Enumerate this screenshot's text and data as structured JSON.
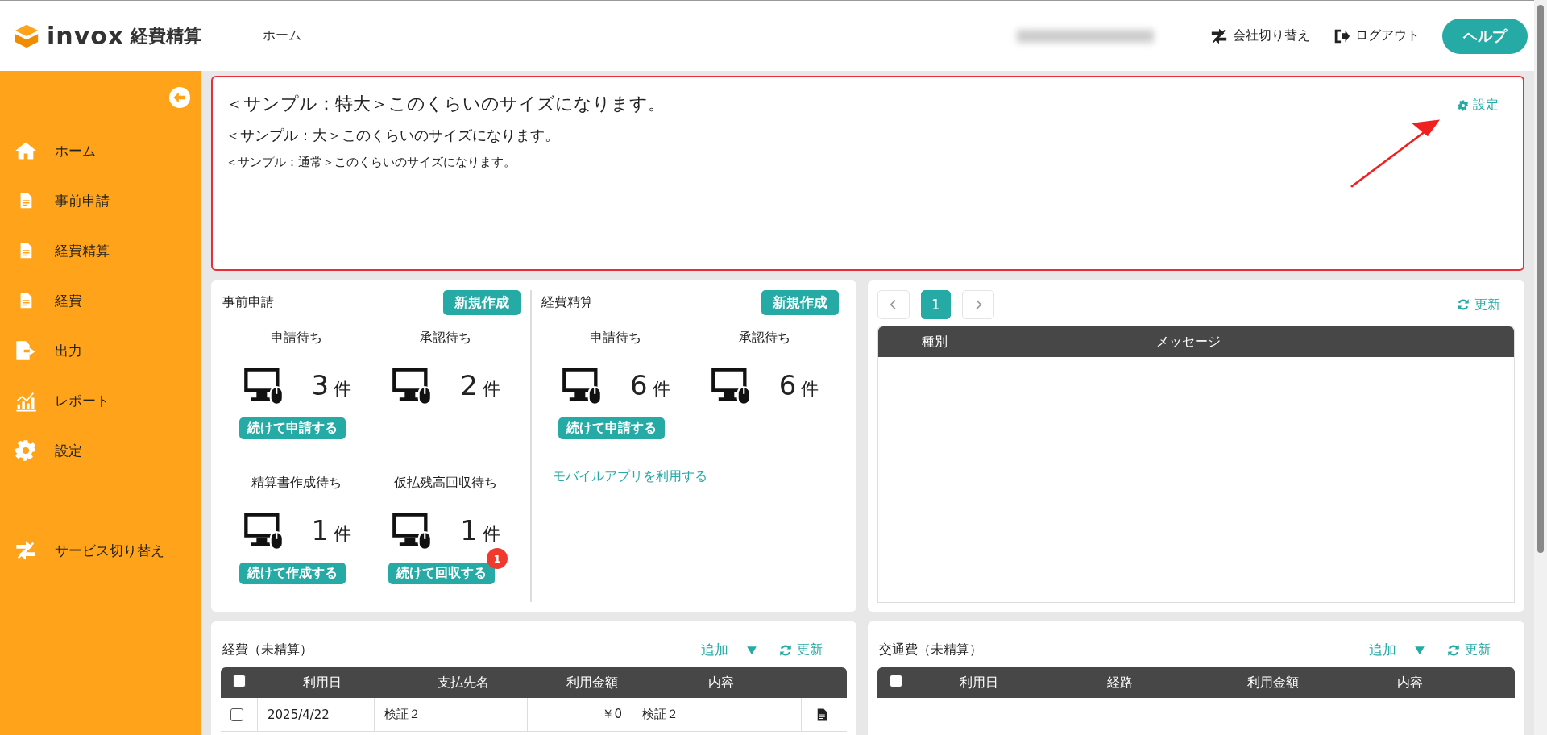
{
  "header": {
    "logo": "invox",
    "product": "経費精算",
    "nav": [
      {
        "label": "ホーム"
      }
    ],
    "actions": [
      {
        "kind": "switch",
        "label": "会社切り替え"
      },
      {
        "kind": "logout",
        "label": "ログアウト"
      }
    ],
    "help": "ヘルプ"
  },
  "sidebar": {
    "items": [
      {
        "kind": "home",
        "label": "ホーム"
      },
      {
        "kind": "doc",
        "label": "事前申請"
      },
      {
        "kind": "doc",
        "label": "経費精算"
      },
      {
        "kind": "doc",
        "label": "経費"
      },
      {
        "kind": "export",
        "label": "出力"
      },
      {
        "kind": "report",
        "label": "レポート"
      },
      {
        "kind": "gear",
        "label": "設定"
      },
      {
        "kind": "switch",
        "label": "サービス切り替え"
      }
    ]
  },
  "notice": {
    "samples": [
      {
        "kind": "xl",
        "text": "＜サンプル：特大＞このくらいのサイズになります。"
      },
      {
        "kind": "lg",
        "text": "＜サンプル：大＞このくらいのサイズになります。"
      },
      {
        "kind": "normal",
        "text": "＜サンプル：通常＞このくらいのサイズになります。"
      }
    ],
    "settings": "設定"
  },
  "status": [
    {
      "title": "事前申請",
      "new_button": "新規作成",
      "cards": [
        {
          "label": "申請待ち",
          "count": "3",
          "unit": "件",
          "action": "続けて申請する"
        },
        {
          "label": "承認待ち",
          "count": "2",
          "unit": "件"
        },
        {
          "label": "精算書作成待ち",
          "count": "1",
          "unit": "件",
          "action": "続けて作成する"
        },
        {
          "label": "仮払残高回収待ち",
          "count": "1",
          "unit": "件",
          "action": "続けて回収する",
          "badge": "1"
        }
      ]
    },
    {
      "title": "経費精算",
      "new_button": "新規作成",
      "cards": [
        {
          "label": "申請待ち",
          "count": "6",
          "unit": "件",
          "action": "続けて申請する"
        },
        {
          "label": "承認待ち",
          "count": "6",
          "unit": "件"
        }
      ],
      "link": "モバイルアプリを利用する"
    }
  ],
  "messages": {
    "pages": [
      {
        "label": "1",
        "selected": true
      }
    ],
    "refresh": "更新",
    "columns": [
      "種別",
      "メッセージ"
    ]
  },
  "tables": [
    {
      "title": "経費（未精算）",
      "add": "追加",
      "refresh": "更新",
      "header_checked": false,
      "columns": [
        "利用日",
        "支払先名",
        "利用金額",
        "内容"
      ],
      "rows": [
        {
          "checked": false,
          "cells": [
            "2025/4/22",
            "検証２",
            "￥0",
            "検証２"
          ]
        }
      ]
    },
    {
      "title": "交通費（未精算）",
      "add": "追加",
      "refresh": "更新",
      "header_checked": false,
      "columns": [
        "利用日",
        "経路",
        "利用金額",
        "内容"
      ]
    }
  ]
}
